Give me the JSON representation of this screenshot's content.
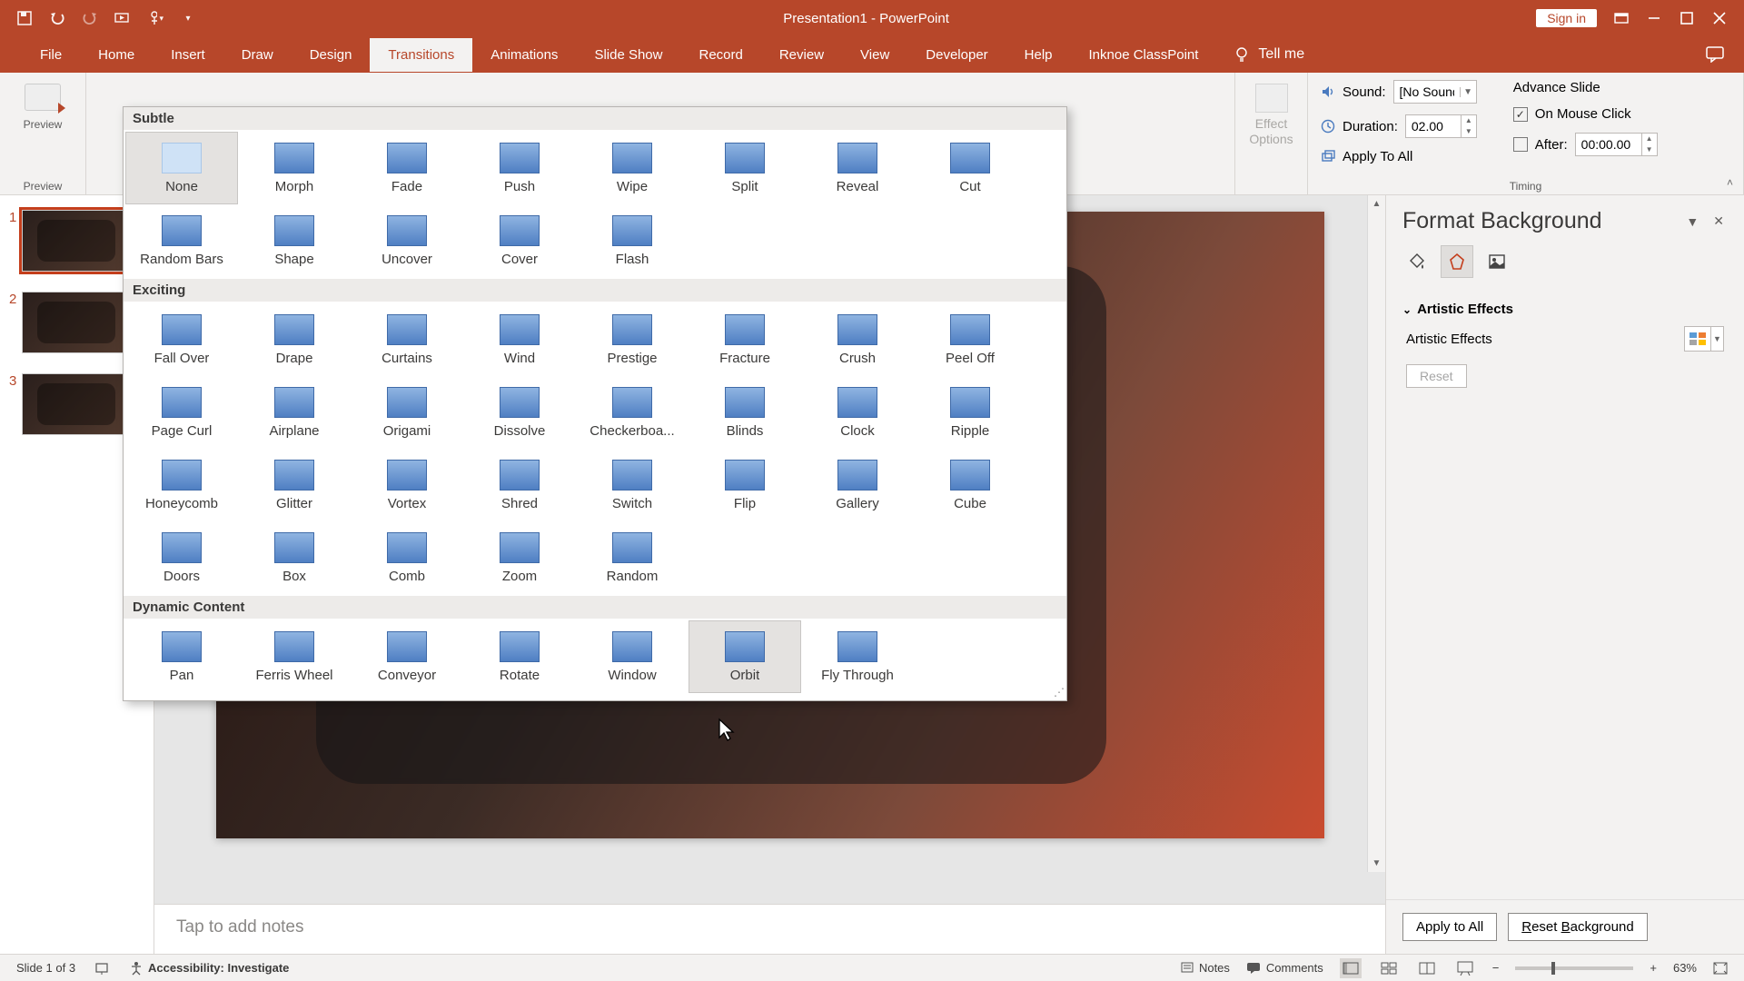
{
  "app": {
    "title": "Presentation1  -  PowerPoint",
    "signin": "Sign in",
    "tellme": "Tell me"
  },
  "ribbon_tabs": [
    "File",
    "Home",
    "Insert",
    "Draw",
    "Design",
    "Transitions",
    "Animations",
    "Slide Show",
    "Record",
    "Review",
    "View",
    "Developer",
    "Help",
    "Inknoe ClassPoint"
  ],
  "active_tab": "Transitions",
  "preview": {
    "label": "Preview",
    "group": "Preview"
  },
  "effect": {
    "label": "Effect\nOptions",
    "caret": "▾"
  },
  "timing": {
    "sound_label": "Sound:",
    "sound_value": "[No Sound]",
    "duration_label": "Duration:",
    "duration_value": "02.00",
    "apply_all": "Apply To All",
    "advance_label": "Advance Slide",
    "on_click": "On Mouse Click",
    "after_label": "After:",
    "after_value": "00:00.00",
    "group": "Timing"
  },
  "gallery": {
    "categories": [
      {
        "label": "Subtle",
        "items": [
          "None",
          "Morph",
          "Fade",
          "Push",
          "Wipe",
          "Split",
          "Reveal",
          "Cut",
          "Random Bars",
          "Shape",
          "Uncover",
          "Cover",
          "Flash"
        ]
      },
      {
        "label": "Exciting",
        "items": [
          "Fall Over",
          "Drape",
          "Curtains",
          "Wind",
          "Prestige",
          "Fracture",
          "Crush",
          "Peel Off",
          "Page Curl",
          "Airplane",
          "Origami",
          "Dissolve",
          "Checkerboa...",
          "Blinds",
          "Clock",
          "Ripple",
          "Honeycomb",
          "Glitter",
          "Vortex",
          "Shred",
          "Switch",
          "Flip",
          "Gallery",
          "Cube",
          "Doors",
          "Box",
          "Comb",
          "Zoom",
          "Random"
        ]
      },
      {
        "label": "Dynamic Content",
        "items": [
          "Pan",
          "Ferris Wheel",
          "Conveyor",
          "Rotate",
          "Window",
          "Orbit",
          "Fly Through"
        ]
      }
    ],
    "selected": "None",
    "hover": "Orbit"
  },
  "thumbnails": [
    1,
    2,
    3
  ],
  "current_slide": 1,
  "notes_placeholder": "Tap to add notes",
  "format_pane": {
    "title": "Format Background",
    "section": "Artistic Effects",
    "row_label": "Artistic Effects",
    "reset": "Reset",
    "apply_all": "Apply to All",
    "reset_bg": "Reset Background"
  },
  "statusbar": {
    "slide": "Slide 1 of 3",
    "accessibility": "Accessibility: Investigate",
    "notes": "Notes",
    "comments": "Comments",
    "zoom": "63%"
  }
}
